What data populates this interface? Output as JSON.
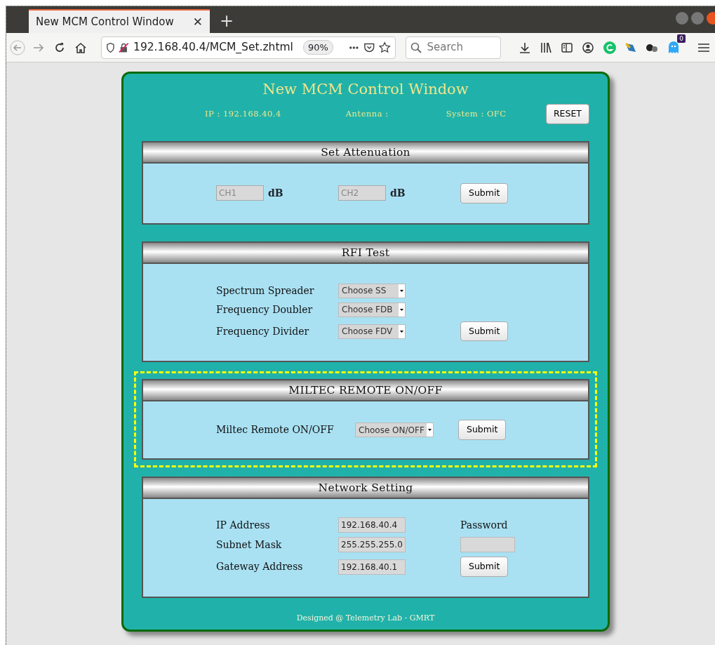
{
  "browser": {
    "tab_title": "New MCM Control Window",
    "tab_close": "✕",
    "new_tab": "+",
    "url": "192.168.40.4/MCM_Set.zhtml",
    "zoom": "90%",
    "search": {
      "placeholder": "Search"
    },
    "addon_badge": "0"
  },
  "page": {
    "title": "New MCM Control Window",
    "info": [
      "IP : 192.168.40.4",
      "Antenna :",
      "System : OFC"
    ],
    "reset_button": "RESET",
    "sections": [
      {
        "kind": "attenuation",
        "title": "Set Attenuation",
        "highlighted": false,
        "channels": [
          {
            "placeholder": "CH1",
            "unit": "dB"
          },
          {
            "placeholder": "CH2",
            "unit": "dB"
          }
        ],
        "submit": "Submit"
      },
      {
        "kind": "selects",
        "title": "RFI Test",
        "highlighted": false,
        "rows": [
          {
            "label": "Spectrum Spreader",
            "select": "Choose SS"
          },
          {
            "label": "Frequency Doubler",
            "select": "Choose FDB"
          },
          {
            "label": "Frequency Divider",
            "select": "Choose FDV"
          }
        ],
        "submit": "Submit"
      },
      {
        "kind": "selects",
        "title": "MILTEC REMOTE ON/OFF",
        "highlighted": true,
        "rows": [
          {
            "label": "Miltec Remote ON/OFF",
            "select": "Choose ON/OFF"
          }
        ],
        "submit": "Submit"
      },
      {
        "kind": "network",
        "title": "Network Setting",
        "highlighted": false,
        "rows": [
          {
            "label": "IP Address",
            "value": "192.168.40.4"
          },
          {
            "label": "Subnet Mask",
            "value": "255.255.255.0"
          },
          {
            "label": "Gateway Address",
            "value": "192.168.40.1"
          }
        ],
        "password_label": "Password",
        "submit": "Submit"
      }
    ],
    "footer": "Designed @ Telemetry Lab - GMRT"
  }
}
